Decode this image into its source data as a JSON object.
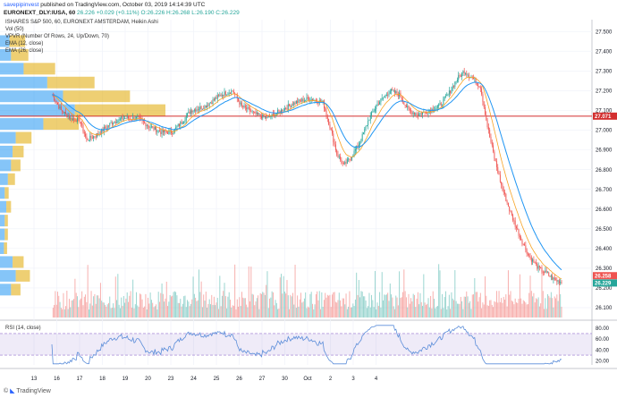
{
  "header": {
    "publisher": "savepipinvest",
    "published_text": "published on TradingView.com, October 03, 2019 14:14:39 UTC",
    "symbol_line": "EURONEXT_DLY:IUSA, 60",
    "open": "26.226",
    "change": "+0.029 (+0.11%)",
    "ohlc": "O:26.226 H:26.268 L:26.190 C:26.229"
  },
  "overlay": {
    "line1": "ISHARES S&P 500, 60, EURONEXT AMSTERDAM, Heikin Ashi",
    "line2": "Vol (50)",
    "line3": "VPVR (Number Of Rows, 24, Up/Down, 70)",
    "line4": "EMA (12, close)",
    "line5": "EMA (26, close)"
  },
  "rsi_label": "RSI (14, close)",
  "footer": {
    "brand": "TradingView"
  },
  "colors": {
    "up": "#26a69a",
    "down": "#ef5350",
    "ema12": "#f7a325",
    "ema26": "#2196f3",
    "hline": "#d32f2f",
    "rsi": "#5b8dd9",
    "vol_up": "#26a69a",
    "vol_down": "#ef5350"
  },
  "chart_data": {
    "type": "candlestick",
    "price_axis_ticks": [
      "27.500",
      "27.400",
      "27.300",
      "27.200",
      "27.100",
      "27.000",
      "26.900",
      "26.800",
      "26.700",
      "26.600",
      "26.500",
      "26.400",
      "26.300",
      "26.200",
      "26.100"
    ],
    "price_range": [
      26.05,
      27.56
    ],
    "x_tick_labels": [
      "13",
      "16",
      "17",
      "18",
      "19",
      "20",
      "23",
      "24",
      "25",
      "26",
      "27",
      "30",
      "Oct",
      "2",
      "3",
      "4"
    ],
    "horizontal_level": 27.071,
    "price_labels": {
      "level": "27.071",
      "last_high": "26.258",
      "last": "26.229"
    },
    "rsi_axis_ticks": [
      "80.00",
      "60.00",
      "40.00",
      "20.00"
    ],
    "rsi_range": [
      12,
      88
    ],
    "rsi_bands": [
      70,
      30
    ],
    "anchors": [
      [
        0,
        27.18
      ],
      [
        8,
        27.1
      ],
      [
        16,
        27.06
      ],
      [
        24,
        27.05
      ],
      [
        30,
        26.95
      ],
      [
        40,
        26.98
      ],
      [
        52,
        27.04
      ],
      [
        62,
        27.06
      ],
      [
        74,
        27.06
      ],
      [
        84,
        27.02
      ],
      [
        94,
        26.99
      ],
      [
        104,
        26.99
      ],
      [
        112,
        27.04
      ],
      [
        120,
        27.1
      ],
      [
        132,
        27.12
      ],
      [
        146,
        27.18
      ],
      [
        156,
        27.2
      ],
      [
        164,
        27.12
      ],
      [
        176,
        27.08
      ],
      [
        186,
        27.06
      ],
      [
        198,
        27.1
      ],
      [
        210,
        27.14
      ],
      [
        222,
        27.16
      ],
      [
        234,
        27.14
      ],
      [
        240,
        27.02
      ],
      [
        246,
        26.88
      ],
      [
        252,
        26.82
      ],
      [
        258,
        26.86
      ],
      [
        266,
        26.94
      ],
      [
        274,
        27.06
      ],
      [
        282,
        27.14
      ],
      [
        292,
        27.2
      ],
      [
        300,
        27.18
      ],
      [
        308,
        27.1
      ],
      [
        316,
        27.08
      ],
      [
        326,
        27.1
      ],
      [
        334,
        27.12
      ],
      [
        342,
        27.18
      ],
      [
        350,
        27.26
      ],
      [
        356,
        27.3
      ],
      [
        364,
        27.26
      ],
      [
        370,
        27.22
      ],
      [
        376,
        27.02
      ],
      [
        382,
        26.86
      ],
      [
        388,
        26.72
      ],
      [
        396,
        26.58
      ],
      [
        404,
        26.46
      ],
      [
        412,
        26.36
      ],
      [
        420,
        26.3
      ],
      [
        428,
        26.27
      ],
      [
        434,
        26.24
      ],
      [
        440,
        26.23
      ]
    ],
    "vpvr_rows": [
      {
        "price": 27.45,
        "up": 12,
        "down": 20
      },
      {
        "price": 27.38,
        "up": 14,
        "down": 22
      },
      {
        "price": 27.31,
        "up": 30,
        "down": 40
      },
      {
        "price": 27.24,
        "up": 60,
        "down": 60
      },
      {
        "price": 27.17,
        "up": 80,
        "down": 85
      },
      {
        "price": 27.1,
        "up": 95,
        "down": 115
      },
      {
        "price": 27.03,
        "up": 55,
        "down": 45
      },
      {
        "price": 26.96,
        "up": 20,
        "down": 20
      },
      {
        "price": 26.89,
        "up": 16,
        "down": 14
      },
      {
        "price": 26.82,
        "up": 14,
        "down": 12
      },
      {
        "price": 26.75,
        "up": 10,
        "down": 9
      },
      {
        "price": 26.68,
        "up": 6,
        "down": 5
      },
      {
        "price": 26.61,
        "up": 8,
        "down": 6
      },
      {
        "price": 26.54,
        "up": 6,
        "down": 4
      },
      {
        "price": 26.47,
        "up": 6,
        "down": 4
      },
      {
        "price": 26.4,
        "up": 5,
        "down": 4
      },
      {
        "price": 26.33,
        "up": 16,
        "down": 14
      },
      {
        "price": 26.26,
        "up": 20,
        "down": 18
      },
      {
        "price": 26.19,
        "up": 14,
        "down": 12
      }
    ]
  }
}
